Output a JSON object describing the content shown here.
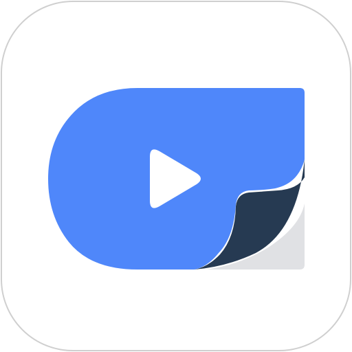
{
  "app_icon": {
    "icon": "video-player-page-curl-icon",
    "colors": {
      "tile_background": "#ffffff",
      "tile_border": "#cfcfcf",
      "primary_blue": "#4f87fa",
      "curl_navy": "#263a52",
      "shadow_gray": "#e0e1e4",
      "play_white": "#ffffff"
    }
  }
}
